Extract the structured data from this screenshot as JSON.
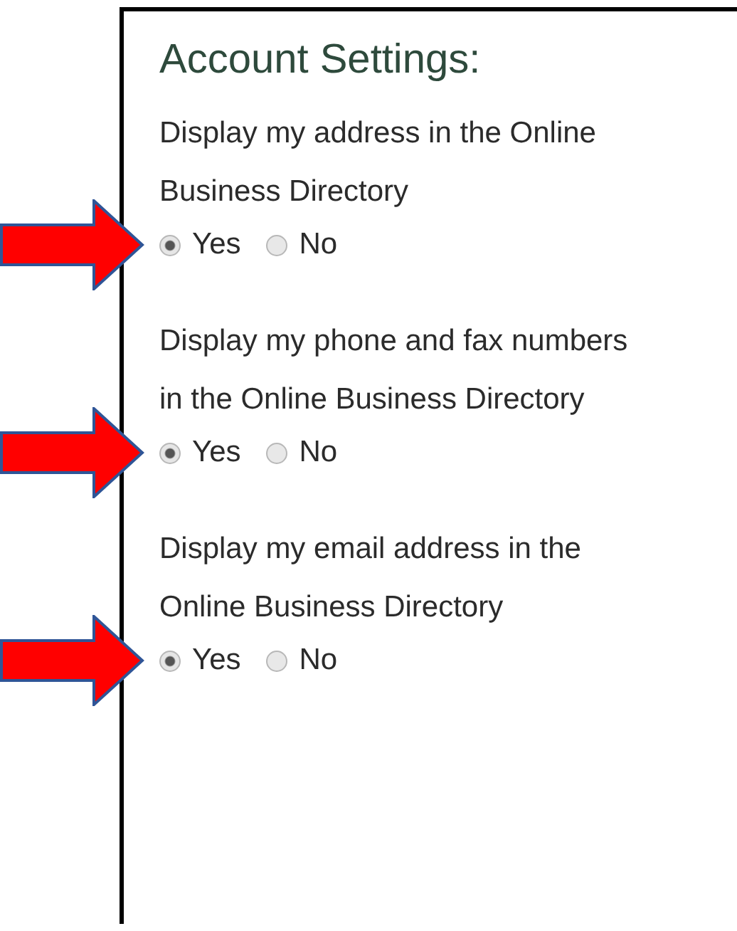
{
  "title": "Account Settings:",
  "questions": [
    {
      "text": "Display my address in the Online Business Directory",
      "highlighted": true,
      "options": [
        {
          "label": "Yes",
          "selected": true
        },
        {
          "label": "No",
          "selected": false
        }
      ]
    },
    {
      "text": "Display my phone and fax numbers in the Online Business Directory",
      "highlighted": true,
      "options": [
        {
          "label": "Yes",
          "selected": true
        },
        {
          "label": "No",
          "selected": false
        }
      ]
    },
    {
      "text": "Display my email address in the Online Business Directory",
      "highlighted": true,
      "options": [
        {
          "label": "Yes",
          "selected": true
        },
        {
          "label": "No",
          "selected": false
        }
      ]
    }
  ]
}
